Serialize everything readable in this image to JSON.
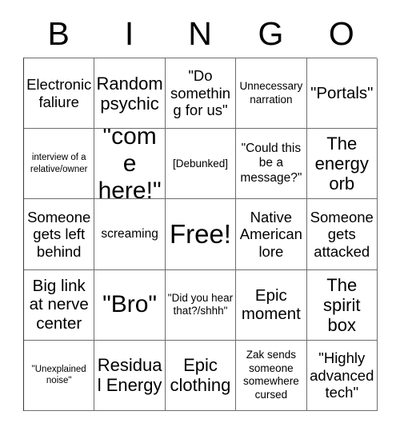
{
  "card": {
    "header_letters": [
      "B",
      "I",
      "N",
      "G",
      "O"
    ],
    "columns": 5,
    "rows": 5,
    "border_color": "#6d6d6d",
    "text_color": "#000000",
    "background_color": "#ffffff",
    "cells": [
      {
        "text": "Electronic faliure",
        "size": "fs-lg",
        "row": 1,
        "col": 1
      },
      {
        "text": "Random psychic",
        "size": "fs-2xl",
        "row": 1,
        "col": 2
      },
      {
        "text": "\"Do something for us\"",
        "size": "fs-lg",
        "row": 1,
        "col": 3
      },
      {
        "text": "Unnecessary narration",
        "size": "fs-sm",
        "row": 1,
        "col": 4
      },
      {
        "text": "\"Portals\"",
        "size": "fs-xl",
        "row": 1,
        "col": 5
      },
      {
        "text": "interview of a relative/owner",
        "size": "fs-xs",
        "row": 2,
        "col": 1
      },
      {
        "text": "\"come here!\"",
        "size": "fs-3xl",
        "row": 2,
        "col": 2
      },
      {
        "text": "[Debunked]",
        "size": "fs-sm",
        "row": 2,
        "col": 3
      },
      {
        "text": "\"Could this be a message?\"",
        "size": "fs-md",
        "row": 2,
        "col": 4
      },
      {
        "text": "The energy orb",
        "size": "fs-2xl",
        "row": 2,
        "col": 5
      },
      {
        "text": "Someone gets left behind",
        "size": "fs-lg",
        "row": 3,
        "col": 1
      },
      {
        "text": "screaming",
        "size": "fs-md",
        "row": 3,
        "col": 2
      },
      {
        "text": "Free!",
        "size": "fs-free",
        "row": 3,
        "col": 3
      },
      {
        "text": "Native American lore",
        "size": "fs-lg",
        "row": 3,
        "col": 4
      },
      {
        "text": "Someone gets attacked",
        "size": "fs-lg",
        "row": 3,
        "col": 5
      },
      {
        "text": "Big link at nerve center",
        "size": "fs-xl",
        "row": 4,
        "col": 1
      },
      {
        "text": "\"Bro\"",
        "size": "fs-3xl",
        "row": 4,
        "col": 2
      },
      {
        "text": "\"Did you hear that?/shhh\"",
        "size": "fs-sm",
        "row": 4,
        "col": 3
      },
      {
        "text": "Epic moment",
        "size": "fs-xl",
        "row": 4,
        "col": 4
      },
      {
        "text": "The spirit box",
        "size": "fs-2xl",
        "row": 4,
        "col": 5
      },
      {
        "text": "\"Unexplained noise\"",
        "size": "fs-xs",
        "row": 5,
        "col": 1
      },
      {
        "text": "Residual Energy",
        "size": "fs-2xl",
        "row": 5,
        "col": 2
      },
      {
        "text": "Epic clothing",
        "size": "fs-2xl",
        "row": 5,
        "col": 3
      },
      {
        "text": "Zak sends someone somewhere cursed",
        "size": "fs-sm",
        "row": 5,
        "col": 4
      },
      {
        "text": "\"Highly advanced tech\"",
        "size": "fs-lg",
        "row": 5,
        "col": 5
      }
    ]
  }
}
